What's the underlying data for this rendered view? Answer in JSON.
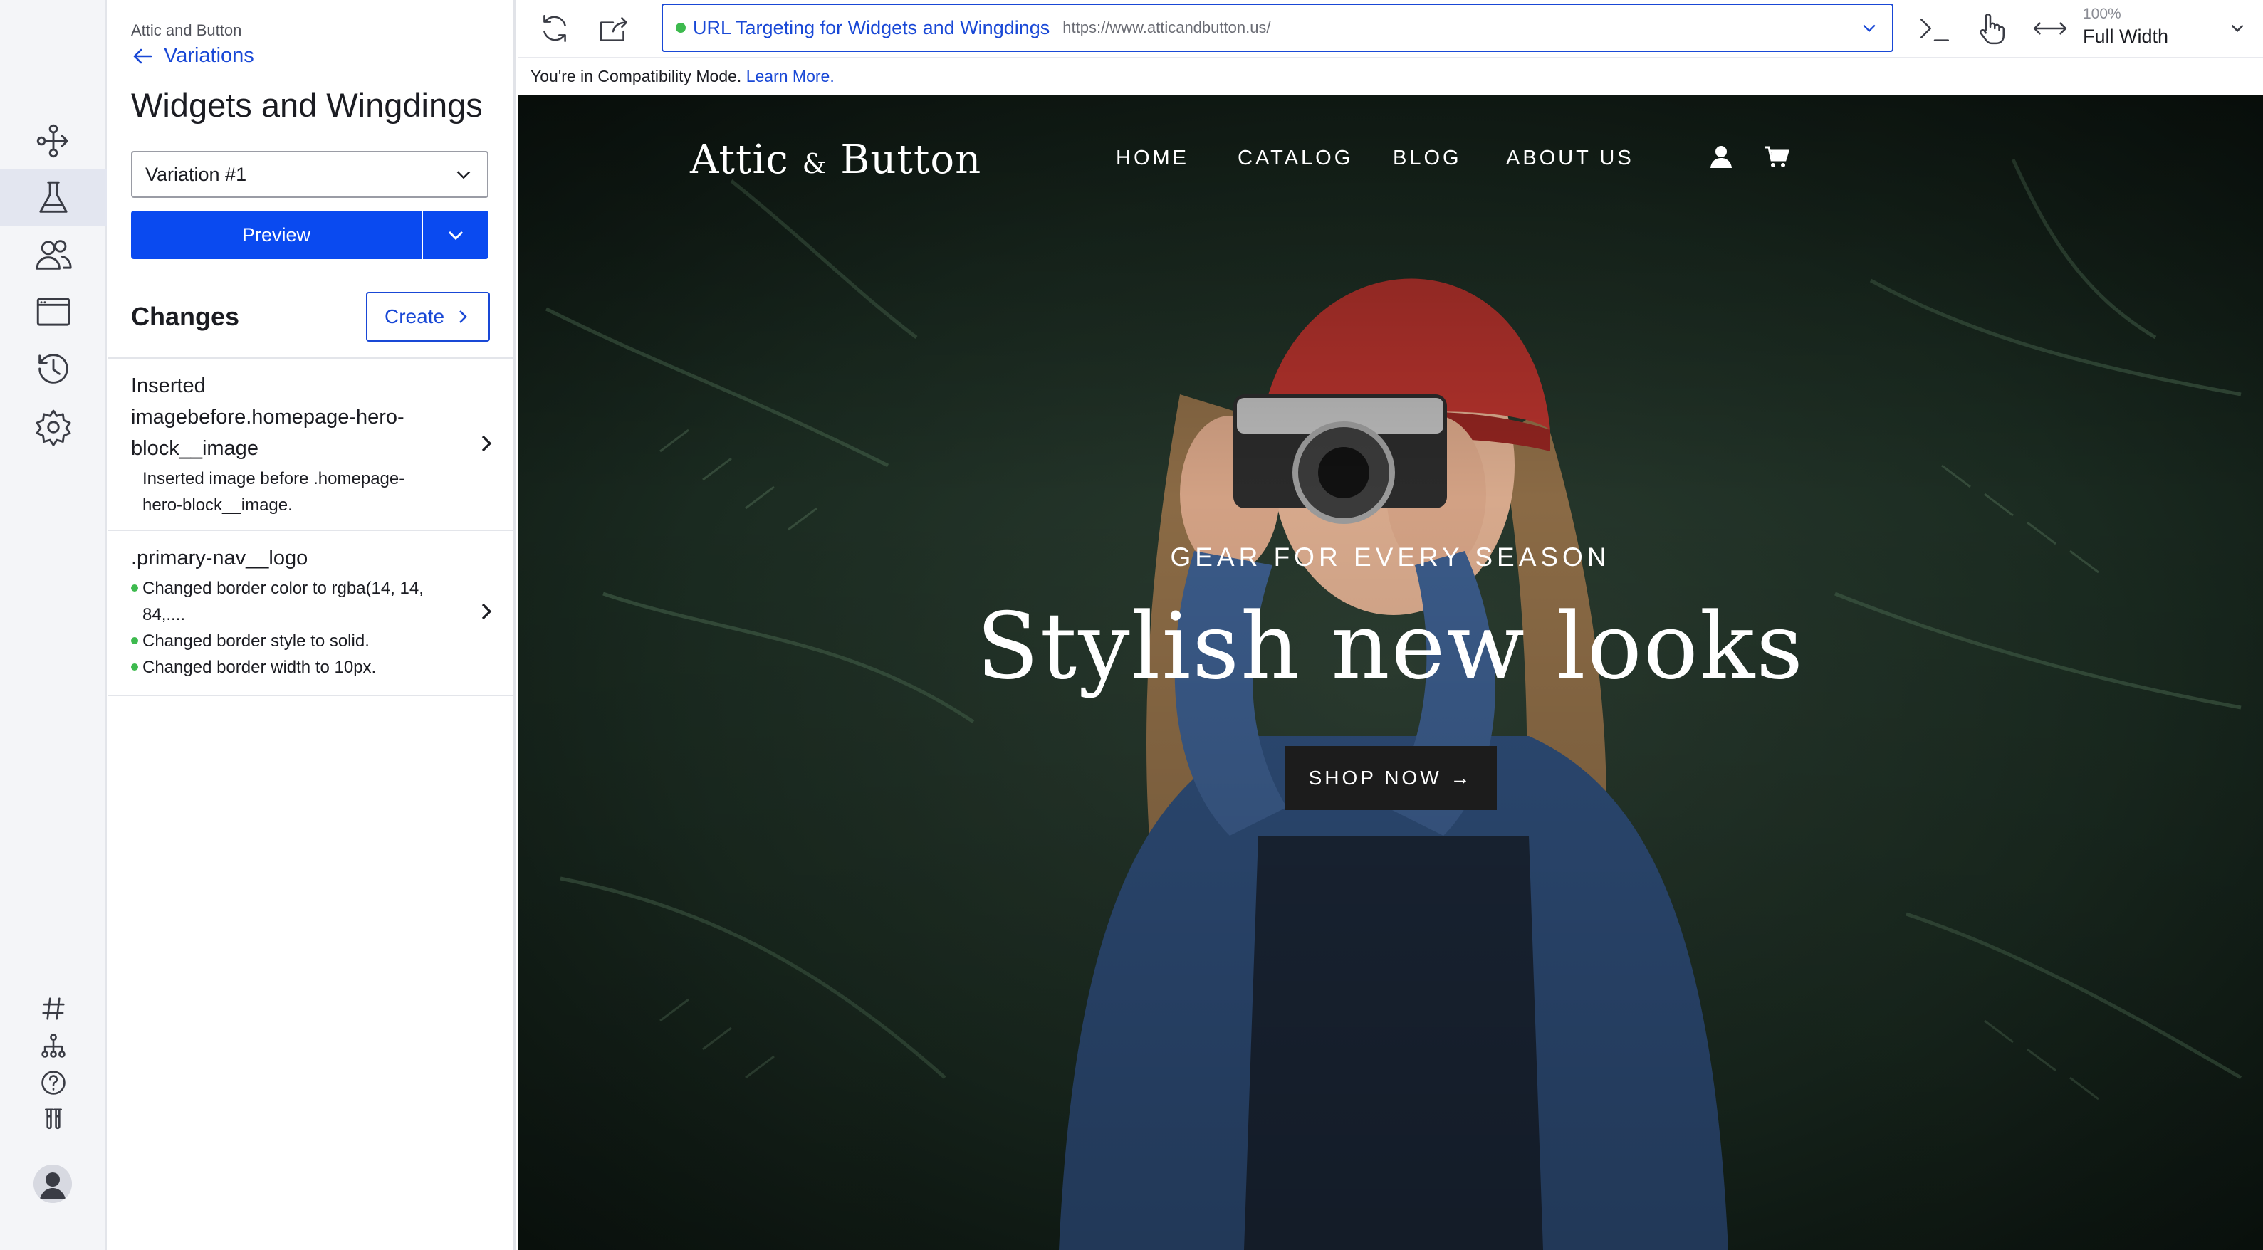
{
  "sidebar_panel": {
    "account_name": "Attic and Button",
    "back_label": "Variations",
    "experiment_title": "Widgets and Wingdings",
    "variation_select": "Variation #1",
    "preview_label": "Preview",
    "changes_heading": "Changes",
    "create_label": "Create",
    "changes": [
      {
        "title_lines": [
          "Inserted",
          "imagebefore.homepage-hero-",
          "block__image"
        ],
        "desc_lines": [
          "Inserted image before .homepage-",
          "hero-block__image."
        ]
      },
      {
        "title_lines": [
          ".primary-nav__logo"
        ],
        "desc_lines": [
          "Changed border color to rgba(14, 14,",
          "84,....",
          "Changed border style to solid.",
          "Changed border width to 10px."
        ]
      }
    ]
  },
  "rail_icons": [
    "flow-icon",
    "flask-icon",
    "audiences-icon",
    "browser-window-icon",
    "history-icon",
    "settings-icon",
    "hashtag-icon",
    "sitemap-icon",
    "help-icon",
    "test-tubes-icon",
    "avatar-icon"
  ],
  "toolbar": {
    "url_target_name": "URL Targeting for Widgets and Wingdings",
    "url_address": "https://www.atticandbutton.us/",
    "width_percent": "100%",
    "width_label": "Full Width"
  },
  "compat": {
    "message": "You're in Compatibility Mode.",
    "link": "Learn More."
  },
  "website": {
    "logo_main": "Attic",
    "logo_amp": "&",
    "logo_end": "Button",
    "nav": [
      "HOME",
      "CATALOG",
      "BLOG",
      "ABOUT US"
    ],
    "hero_subtitle": "GEAR FOR EVERY SEASON",
    "hero_title": "Stylish new looks",
    "hero_button": "SHOP NOW →"
  },
  "colors": {
    "accent": "#0a4af0",
    "link": "#1948d6",
    "status_dot": "#3dba4e"
  }
}
